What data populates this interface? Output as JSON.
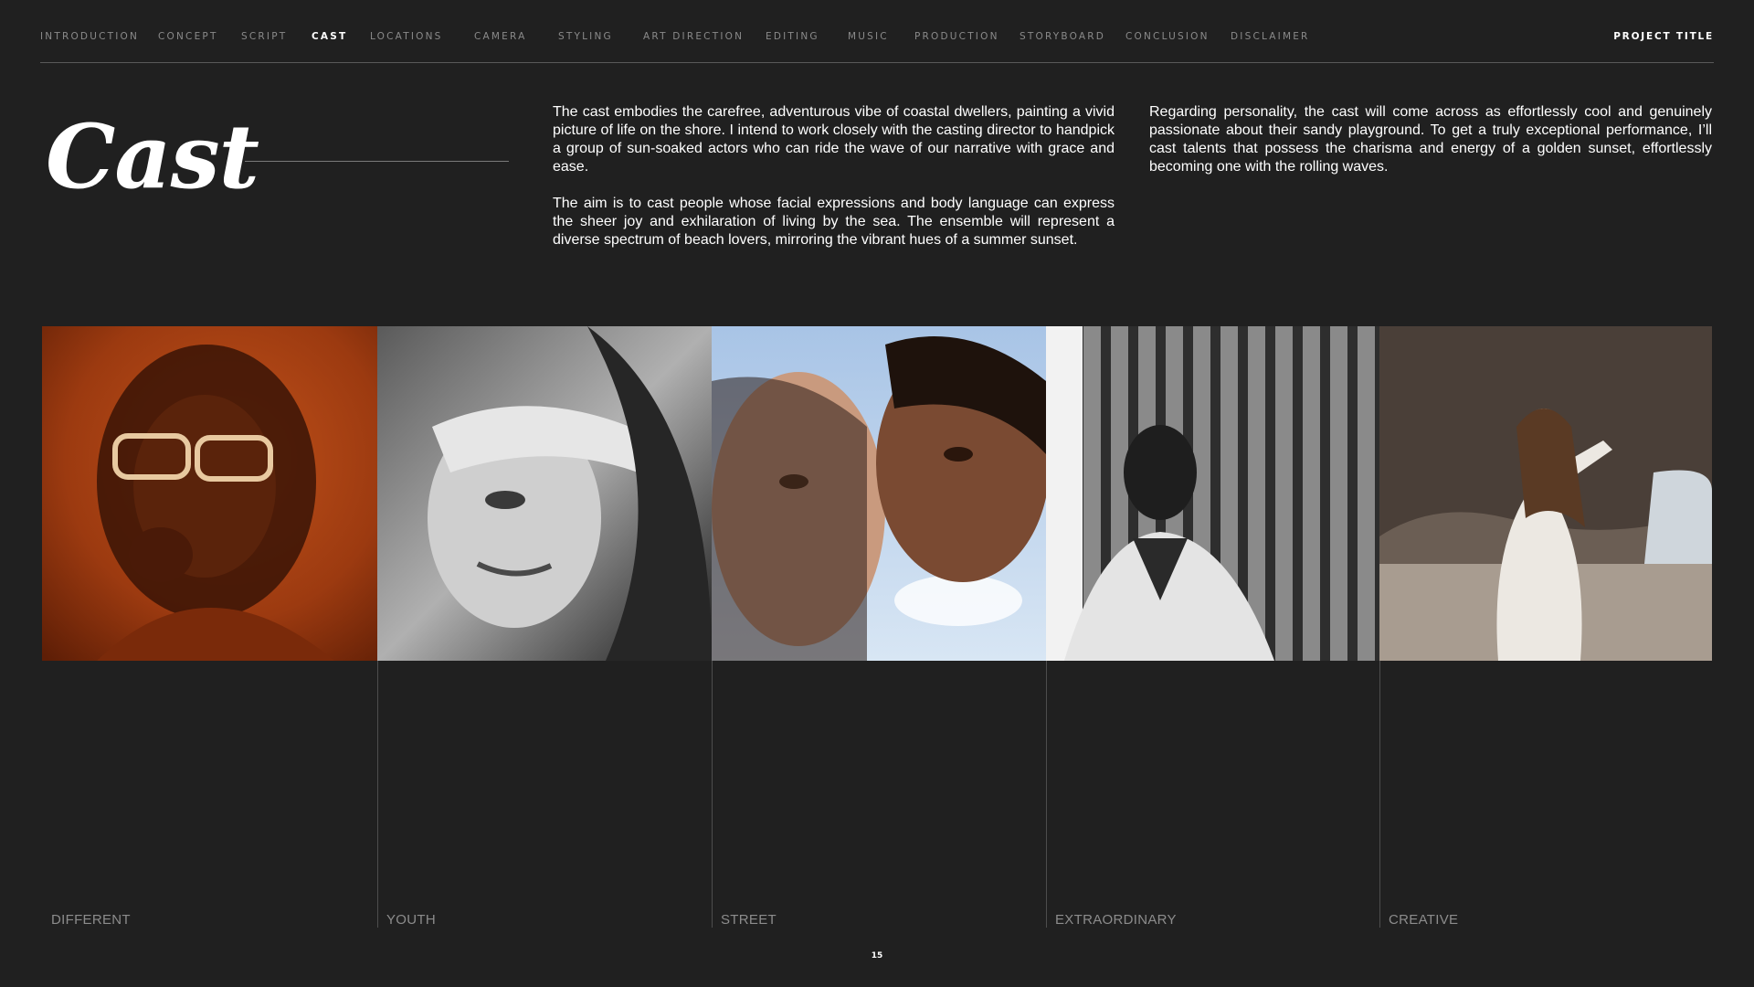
{
  "nav": {
    "items": [
      {
        "label": "INTRODUCTION",
        "active": false
      },
      {
        "label": "CONCEPT",
        "active": false
      },
      {
        "label": "SCRIPT",
        "active": false
      },
      {
        "label": "CAST",
        "active": true
      },
      {
        "label": "LOCATIONS",
        "active": false
      },
      {
        "label": "CAMERA",
        "active": false
      },
      {
        "label": "STYLING",
        "active": false
      },
      {
        "label": "ART DIRECTION",
        "active": false
      },
      {
        "label": "EDITING",
        "active": false
      },
      {
        "label": "MUSIC",
        "active": false
      },
      {
        "label": "PRODUCTION",
        "active": false
      },
      {
        "label": "STORYBOARD",
        "active": false
      },
      {
        "label": "CONCLUSION",
        "active": false
      },
      {
        "label": "DISCLAIMER",
        "active": false
      }
    ],
    "project_title": "PROJECT TITLE"
  },
  "heading": "Cast",
  "copy": {
    "col1": [
      "The cast embodies the carefree, adventurous vibe of coastal dwellers, painting a vivid picture of life on the shore. I intend to work closely with the casting director to handpick a group of sun-soaked actors who can ride the wave of our narrative with grace and ease.",
      "The aim is to cast people whose facial expressions and body language can express the sheer joy and exhilaration of living by the sea. The ensemble will represent a diverse spectrum of beach lovers, mirroring the vibrant hues of a summer sunset."
    ],
    "col2": [
      "Regarding personality, the cast will come across as effortlessly cool and genuinely passionate about their sandy playground. To get a truly exceptional performance, I’ll cast talents that possess the charisma and energy of a golden sunset, effortlessly becoming one with the rolling waves."
    ]
  },
  "cast": [
    {
      "label": "DIFFERENT"
    },
    {
      "label": "YOUTH"
    },
    {
      "label": "STREET"
    },
    {
      "label": "EXTRAORDINARY"
    },
    {
      "label": "CREATIVE"
    }
  ],
  "page_number": "15",
  "colors": {
    "background": "#202020",
    "text": "#ffffff",
    "muted": "#8a8a8a",
    "divider": "#4d4d4d"
  }
}
